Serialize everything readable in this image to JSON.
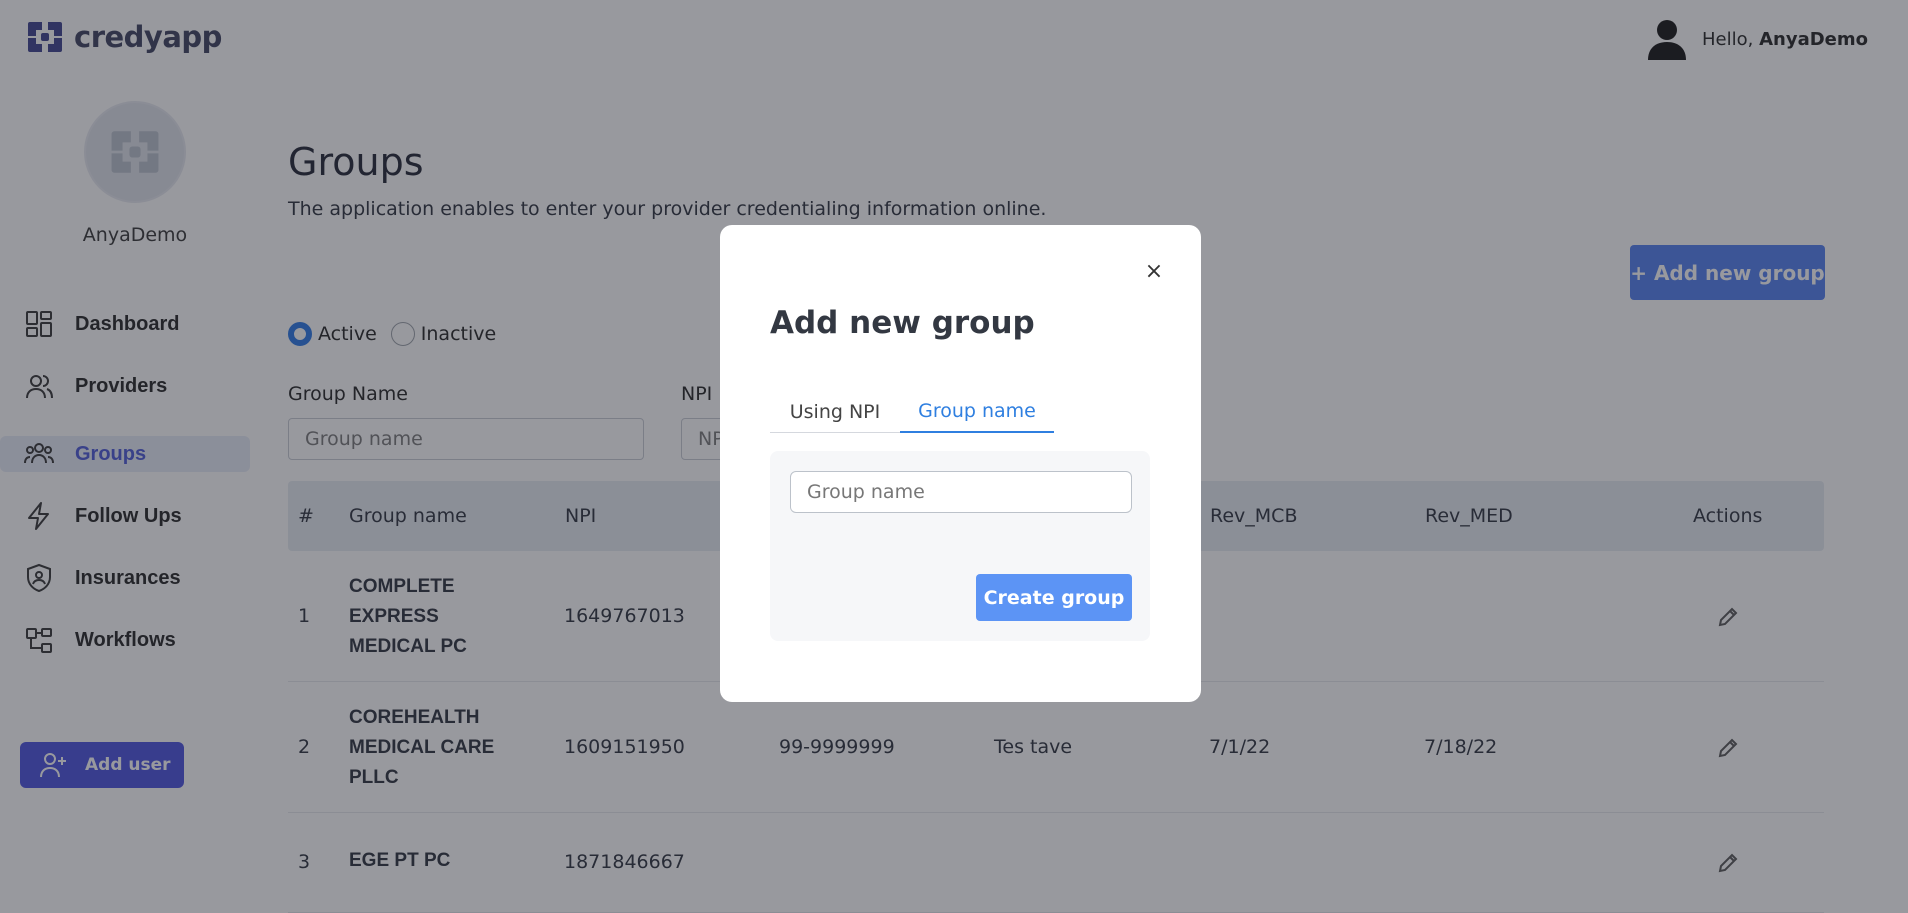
{
  "app": {
    "logo_text": "credyapp"
  },
  "header": {
    "greeting": "Hello,",
    "username": "AnyaDemo"
  },
  "sidebar": {
    "profile_name": "AnyaDemo",
    "items": [
      {
        "label": "Dashboard",
        "icon": "dashboard-icon",
        "active": false
      },
      {
        "label": "Providers",
        "icon": "users-icon",
        "active": false
      },
      {
        "label": "Groups",
        "icon": "group-icon",
        "active": true
      },
      {
        "label": "Follow Ups",
        "icon": "lightning-icon",
        "active": false
      },
      {
        "label": "Insurances",
        "icon": "shield-icon",
        "active": false
      },
      {
        "label": "Workflows",
        "icon": "workflow-icon",
        "active": false
      }
    ],
    "add_user_label": "Add user"
  },
  "main": {
    "title": "Groups",
    "subtitle": "The application enables to enter your provider credentialing information online.",
    "add_group_label": "+ Add new group",
    "status_filter": {
      "options": [
        "Active",
        "Inactive"
      ],
      "selected": "Active"
    },
    "filters": {
      "group_name_label": "Group Name",
      "group_name_placeholder": "Group name",
      "npi_label": "NPI",
      "npi_placeholder": "NPI"
    },
    "table": {
      "columns": [
        "#",
        "Group name",
        "NPI",
        "Rev_MCB",
        "Rev_MED",
        "Actions"
      ],
      "rows": [
        {
          "num": "1",
          "name": "COMPLETE EXPRESS MEDICAL PC",
          "npi": "1649767013",
          "tax_id": "",
          "contact": "",
          "rev_mcb": "",
          "rev_med": ""
        },
        {
          "num": "2",
          "name": "COREHEALTH MEDICAL CARE PLLC",
          "npi": "1609151950",
          "tax_id": "99-9999999",
          "contact": "Tes tave",
          "rev_mcb": "7/1/22",
          "rev_med": "7/18/22"
        },
        {
          "num": "3",
          "name": "EGE PT PC",
          "npi": "1871846667",
          "tax_id": "",
          "contact": "",
          "rev_mcb": "",
          "rev_med": ""
        }
      ]
    }
  },
  "modal": {
    "title": "Add new group",
    "close_label": "×",
    "tabs": [
      {
        "label": "Using NPI",
        "active": false
      },
      {
        "label": "Group name",
        "active": true
      }
    ],
    "group_name_placeholder": "Group name",
    "submit_label": "Create group"
  },
  "colors": {
    "brand": "#4750de",
    "primary_button": "#4f7df0",
    "tab_active": "#2f7fe0",
    "overlay": "rgba(40,42,52,0.48)"
  }
}
